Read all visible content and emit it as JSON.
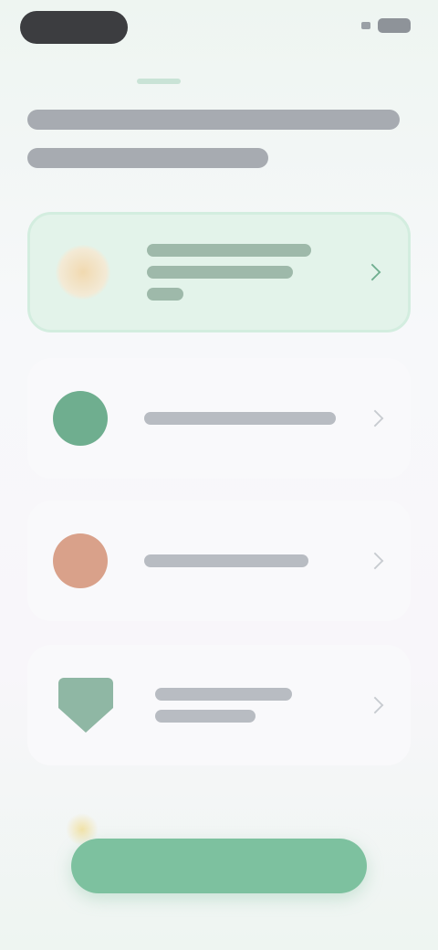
{
  "colors": {
    "accent": "#7dc19f",
    "selected_bg": "#e3f3ea",
    "card_bg": "#f9f9fb",
    "option_1_icon": "#f1d9b0",
    "option_2_icon": "#6fae8f",
    "option_3_icon": "#d9a18a",
    "option_4_icon": "#8fb7a4"
  },
  "icons": {
    "option_1": "tag-icon",
    "option_2": "circle-icon",
    "option_3": "circle-icon",
    "option_4": "shield-icon",
    "chevron": "chevron-right-icon"
  }
}
